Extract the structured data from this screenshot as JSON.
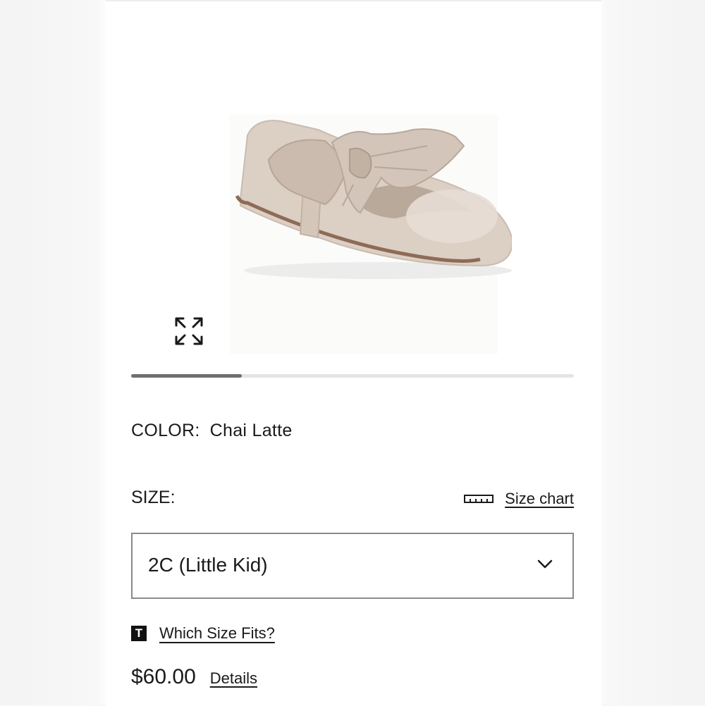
{
  "product": {
    "image_alt": "Chai Latte patent ballet flat with oversized fabric bow",
    "carousel": {
      "current_fraction": 0.25
    }
  },
  "icons": {
    "expand": "expand-arrows-icon",
    "ruler": "ruler-icon",
    "chevron": "chevron-down-icon",
    "fit_badge": "T"
  },
  "color": {
    "label": "COLOR:",
    "value": "Chai Latte"
  },
  "size": {
    "label": "SIZE:",
    "chart_link": "Size chart",
    "selected": "2C (Little Kid)"
  },
  "fit": {
    "badge": "T",
    "link": "Which Size Fits?"
  },
  "price": {
    "amount": "$60.00",
    "details_link": "Details"
  },
  "colors": {
    "accent_text": "#1a1a1a",
    "border": "#8a8a8a",
    "progress_fill": "#6f6f6f",
    "progress_track": "#e4e4e4"
  }
}
